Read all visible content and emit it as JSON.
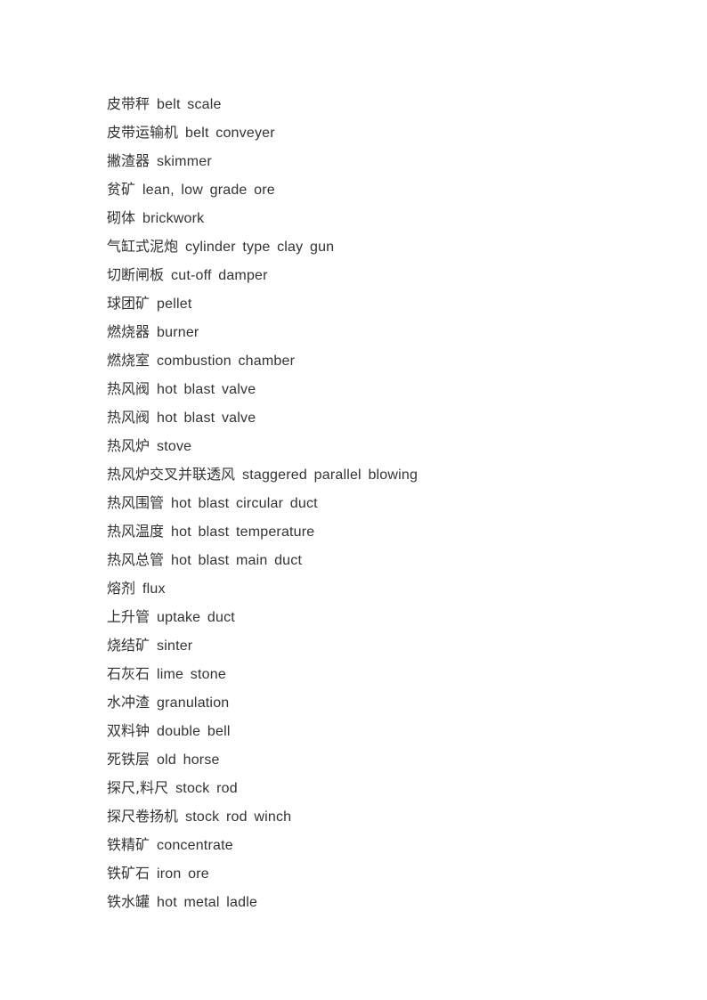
{
  "document": {
    "entries": [
      {
        "zh": "皮带秤",
        "en": "belt scale"
      },
      {
        "zh": "皮带运输机",
        "en": "belt conveyer"
      },
      {
        "zh": "撇渣器",
        "en": "skimmer"
      },
      {
        "zh": "贫矿",
        "en": "lean, low grade ore"
      },
      {
        "zh": "砌体",
        "en": "brickwork"
      },
      {
        "zh": "气缸式泥炮",
        "en": "cylinder type clay gun"
      },
      {
        "zh": "切断闸板",
        "en": "cut-off damper"
      },
      {
        "zh": "球团矿",
        "en": "pellet"
      },
      {
        "zh": "燃烧器",
        "en": "burner"
      },
      {
        "zh": "燃烧室",
        "en": "combustion chamber"
      },
      {
        "zh": "热风阀",
        "en": "hot blast valve"
      },
      {
        "zh": "热风阀",
        "en": "hot blast valve"
      },
      {
        "zh": "热风炉",
        "en": "stove"
      },
      {
        "zh": "热风炉交叉并联透风",
        "en": "staggered parallel blowing"
      },
      {
        "zh": "热风围管",
        "en": "hot blast circular duct"
      },
      {
        "zh": "热风温度",
        "en": "hot blast temperature"
      },
      {
        "zh": "热风总管",
        "en": "hot blast main duct"
      },
      {
        "zh": "熔剂",
        "en": "flux"
      },
      {
        "zh": "上升管",
        "en": "uptake duct"
      },
      {
        "zh": "烧结矿",
        "en": "sinter"
      },
      {
        "zh": "石灰石",
        "en": "lime stone"
      },
      {
        "zh": "水冲渣",
        "en": "granulation"
      },
      {
        "zh": "双料钟",
        "en": "double bell"
      },
      {
        "zh": "死铁层",
        "en": "old horse"
      },
      {
        "zh": "探尺,料尺",
        "en": "stock rod"
      },
      {
        "zh": "探尺卷扬机",
        "en": "stock rod winch"
      },
      {
        "zh": "铁精矿",
        "en": "concentrate"
      },
      {
        "zh": "铁矿石",
        "en": "iron ore"
      },
      {
        "zh": "铁水罐",
        "en": "hot metal ladle"
      }
    ]
  }
}
